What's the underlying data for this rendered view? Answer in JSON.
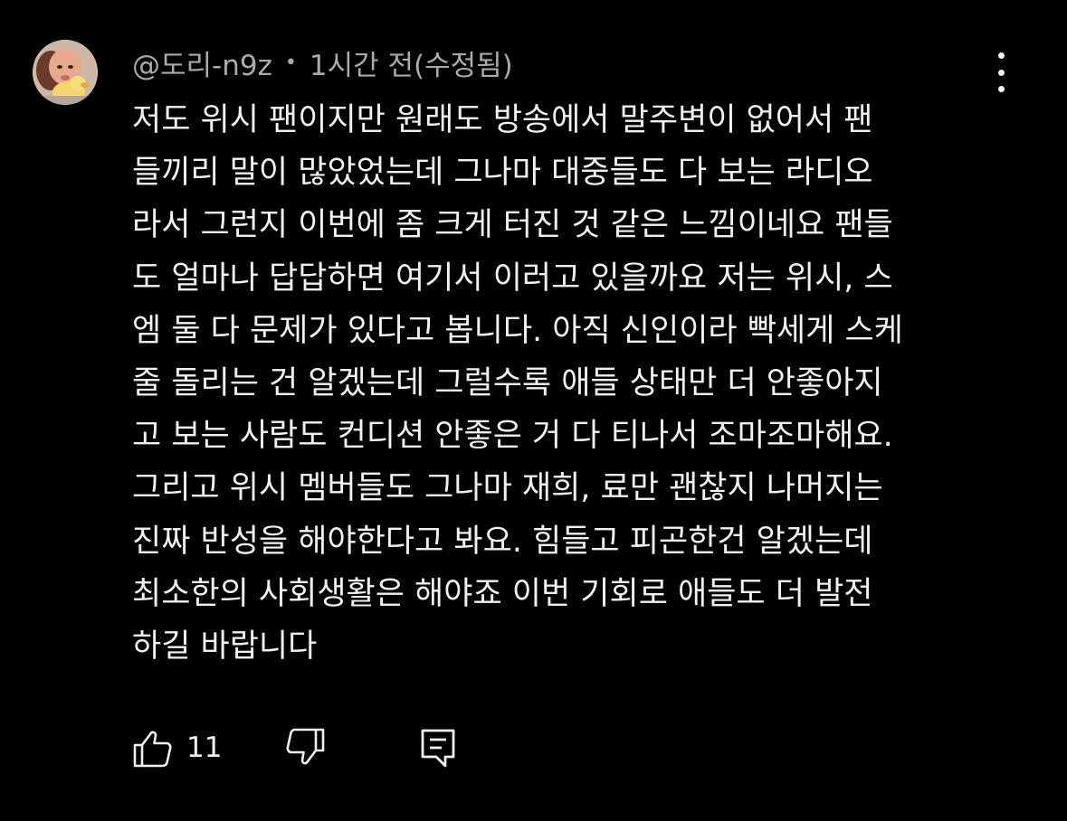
{
  "comment": {
    "author": "@도리-n9z",
    "separator": "•",
    "timestamp": "1시간 전(수정됨)",
    "body": "저도 위시 팬이지만 원래도 방송에서 말주변이 없어서 팬\n들끼리 말이 많았었는데 그나마 대중들도 다 보는 라디오\n라서 그런지 이번에 좀 크게 터진 것 같은 느낌이네요 팬들\n도 얼마나 답답하면 여기서 이러고 있을까요 저는 위시, 스\n엠 둘 다 문제가 있다고 봅니다. 아직 신인이라 빡세게 스케\n줄 돌리는 건 알겠는데 그럴수록 애들 상태만 더 안좋아지\n고 보는 사람도 컨디션 안좋은 거 다 티나서 조마조마해요.\n그리고 위시 멤버들도 그나마 재희, 료만 괜찮지 나머지는\n진짜 반성을 해야한다고 봐요. 힘들고 피곤한건 알겠는데\n최소한의 사회생활은 해야죠 이번 기회로 애들도 더 발전\n하길 바랍니다",
    "like_count": "11"
  },
  "icons": {
    "avatar": "avatar-image",
    "menu": "more-vertical-icon",
    "like": "thumbs-up-icon",
    "dislike": "thumbs-down-icon",
    "reply": "reply-comment-icon"
  },
  "colors": {
    "background": "#000000",
    "text_primary": "#f1f1f1",
    "text_secondary": "#aaaaaa"
  }
}
